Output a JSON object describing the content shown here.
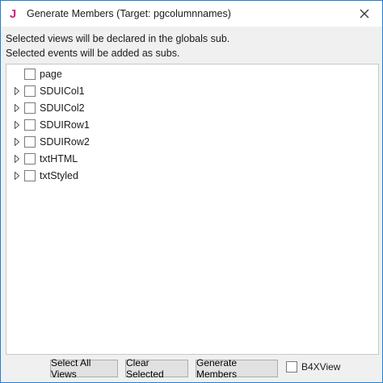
{
  "window": {
    "title": "Generate Members (Target: pgcolumnnames)",
    "app_icon_letter": "J",
    "app_icon_color": "#d6247c",
    "close_icon": "close-icon",
    "border_color": "#1e7fd6"
  },
  "info": {
    "line1": "Selected views will be declared in the globals sub.",
    "line2": "Selected events will be added as subs."
  },
  "tree": {
    "items": [
      {
        "label": "page",
        "expandable": false,
        "checked": false
      },
      {
        "label": "SDUICol1",
        "expandable": true,
        "checked": false
      },
      {
        "label": "SDUICol2",
        "expandable": true,
        "checked": false
      },
      {
        "label": "SDUIRow1",
        "expandable": true,
        "checked": false
      },
      {
        "label": "SDUIRow2",
        "expandable": true,
        "checked": false
      },
      {
        "label": "txtHTML",
        "expandable": true,
        "checked": false
      },
      {
        "label": "txtStyled",
        "expandable": true,
        "checked": false
      }
    ]
  },
  "footer": {
    "select_all_label": "Select All Views",
    "clear_selected_label": "Clear Selected",
    "generate_label": "Generate Members",
    "b4xview_label": "B4XView",
    "b4xview_checked": false
  }
}
